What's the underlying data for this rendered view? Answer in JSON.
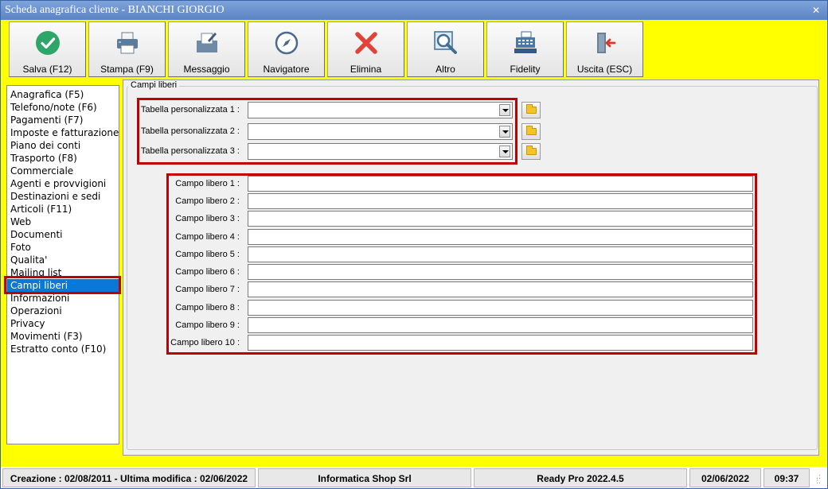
{
  "window": {
    "title": "Scheda anagrafica cliente - BIANCHI GIORGIO",
    "close_label": "✕"
  },
  "toolbar": {
    "buttons": [
      {
        "label": "Salva (F12)",
        "icon": "check-icon"
      },
      {
        "label": "Stampa (F9)",
        "icon": "printer-icon"
      },
      {
        "label": "Messaggio",
        "icon": "message-icon"
      },
      {
        "label": "Navigatore",
        "icon": "compass-icon"
      },
      {
        "label": "Elimina",
        "icon": "delete-x-icon"
      },
      {
        "label": "Altro",
        "icon": "magnifier-icon"
      },
      {
        "label": "Fidelity",
        "icon": "cash-register-icon"
      },
      {
        "label": "Uscita (ESC)",
        "icon": "exit-door-icon"
      }
    ]
  },
  "sidebar": {
    "items": [
      {
        "label": "Anagrafica (F5)"
      },
      {
        "label": "Telefono/note (F6)"
      },
      {
        "label": "Pagamenti (F7)"
      },
      {
        "label": "Imposte e fatturazione"
      },
      {
        "label": "Piano dei conti"
      },
      {
        "label": "Trasporto (F8)"
      },
      {
        "label": "Commerciale"
      },
      {
        "label": "Agenti e provvigioni"
      },
      {
        "label": "Destinazioni e sedi"
      },
      {
        "label": "Articoli (F11)"
      },
      {
        "label": "Web"
      },
      {
        "label": "Documenti"
      },
      {
        "label": "Foto"
      },
      {
        "label": "Qualita'"
      },
      {
        "label": "Mailing list"
      },
      {
        "label": "Campi liberi"
      },
      {
        "label": "Informazioni"
      },
      {
        "label": "Operazioni"
      },
      {
        "label": "Privacy"
      },
      {
        "label": "Movimenti (F3)"
      },
      {
        "label": "Estratto conto (F10)"
      }
    ],
    "active": "Campi liberi"
  },
  "panel": {
    "group_title": "Campi liberi",
    "custom_tables": [
      {
        "label": "Tabella personalizzata 1 :",
        "value": ""
      },
      {
        "label": "Tabella personalizzata 2 :",
        "value": ""
      },
      {
        "label": "Tabella personalizzata 3 :",
        "value": ""
      }
    ],
    "free_fields": [
      {
        "label": "Campo libero 1 :",
        "value": ""
      },
      {
        "label": "Campo libero 2 :",
        "value": ""
      },
      {
        "label": "Campo libero 3 :",
        "value": ""
      },
      {
        "label": "Campo libero 4 :",
        "value": ""
      },
      {
        "label": "Campo libero 5 :",
        "value": ""
      },
      {
        "label": "Campo libero 6 :",
        "value": ""
      },
      {
        "label": "Campo libero 7 :",
        "value": ""
      },
      {
        "label": "Campo libero 8 :",
        "value": ""
      },
      {
        "label": "Campo libero 9 :",
        "value": ""
      },
      {
        "label": "Campo libero 10 :",
        "value": ""
      }
    ]
  },
  "statusbar": {
    "dates": "Creazione : 02/08/2011 - Ultima modifica : 02/06/2022",
    "company": "Informatica Shop Srl",
    "version": "Ready Pro 2022.4.5",
    "date": "02/06/2022",
    "time": "09:37"
  },
  "colors": {
    "background": "#ffff00",
    "highlight": "#c00000",
    "selection": "#0a78d7"
  }
}
